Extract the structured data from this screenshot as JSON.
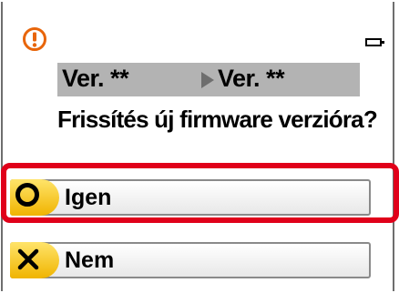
{
  "dialog": {
    "version_from": "Ver. **",
    "version_to": "Ver. **",
    "question": "Frissítés új firmware verzióra?"
  },
  "options": [
    {
      "label": "Igen",
      "icon": "circle-o-icon",
      "selected": true
    },
    {
      "label": "Nem",
      "icon": "cross-x-icon",
      "selected": false
    }
  ],
  "colors": {
    "warning": "#e8650a",
    "badge": "#f5c400",
    "highlight": "#e0001a",
    "version_bar": "#b3b3b3"
  }
}
